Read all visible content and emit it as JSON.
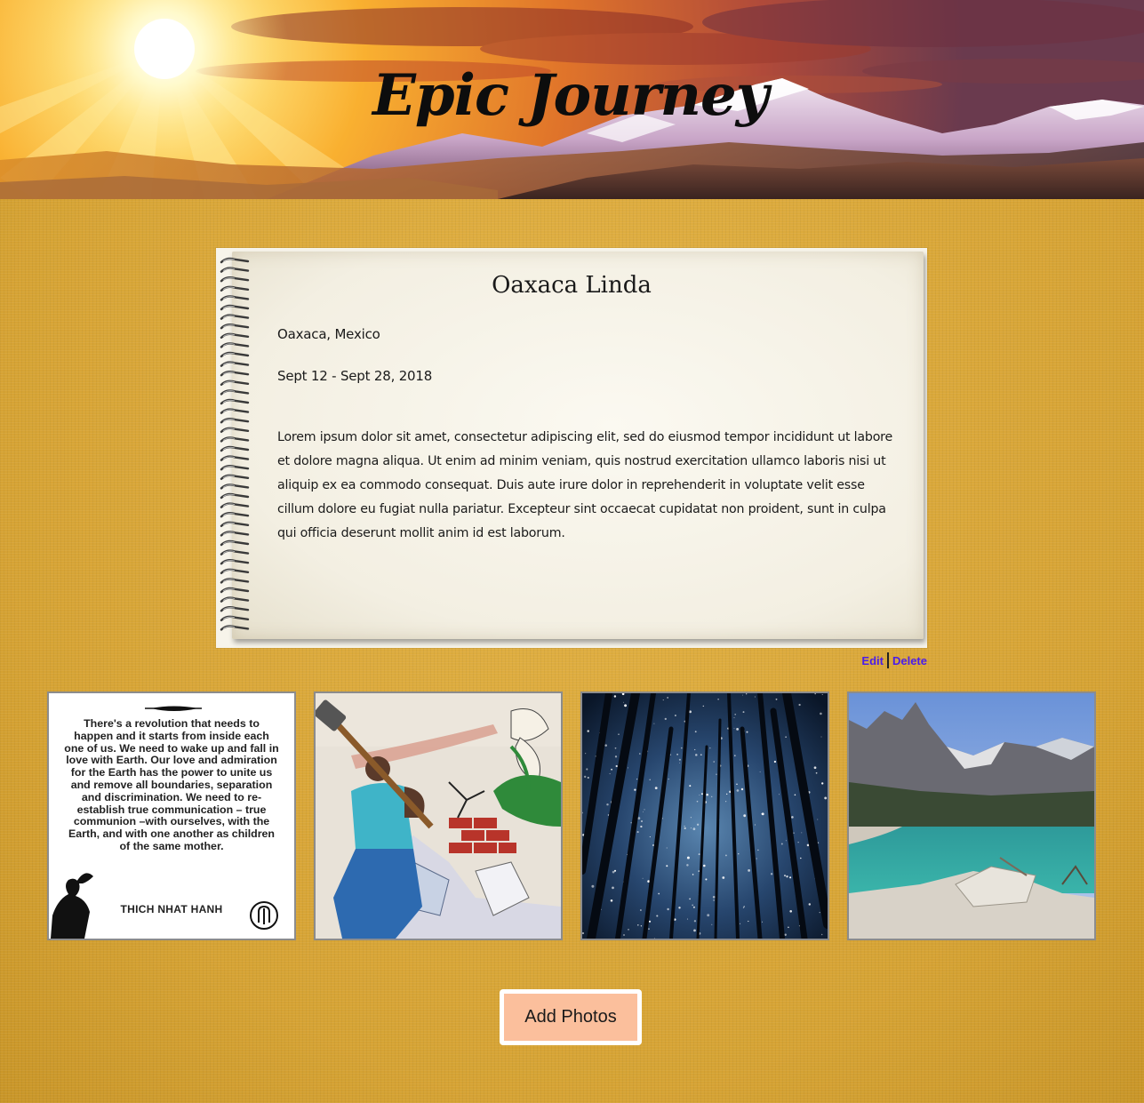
{
  "header": {
    "title": "Epic Journey"
  },
  "entry": {
    "title": "Oaxaca Linda",
    "location": "Oaxaca, Mexico",
    "dates": "Sept 12 - Sept 28, 2018",
    "body": "Lorem ipsum dolor sit amet, consectetur adipiscing elit, sed do eiusmod tempor incididunt ut labore et dolore magna aliqua. Ut enim ad minim veniam, quis nostrud exercitation ullamco laboris nisi ut aliquip ex ea commodo consequat. Duis aute irure dolor in reprehenderit in voluptate velit esse cillum dolore eu fugiat nulla pariatur. Excepteur sint occaecat cupidatat non proident, sunt in culpa qui officia deserunt mollit anim id est laborum."
  },
  "actions": {
    "edit_label": "Edit",
    "delete_label": "Delete",
    "link_color": "#4b1de8"
  },
  "gallery": {
    "quote": {
      "text": "There's a revolution that needs to happen and it starts from inside each one of us. We need to wake up and fall in love with Earth. Our love and admiration for the Earth has the power to unite us and remove all boundaries, separation and discrimination. We need to re-establish true communication – true communion –with ourselves, with the Earth, and with one another as children of the same mother.",
      "author": "THICH NHAT HANH"
    }
  },
  "add_photos_label": "Add Photos",
  "colors": {
    "background": "#d9a83a",
    "button": "#fbbf9c",
    "photo_border": "#8c8c8c"
  }
}
